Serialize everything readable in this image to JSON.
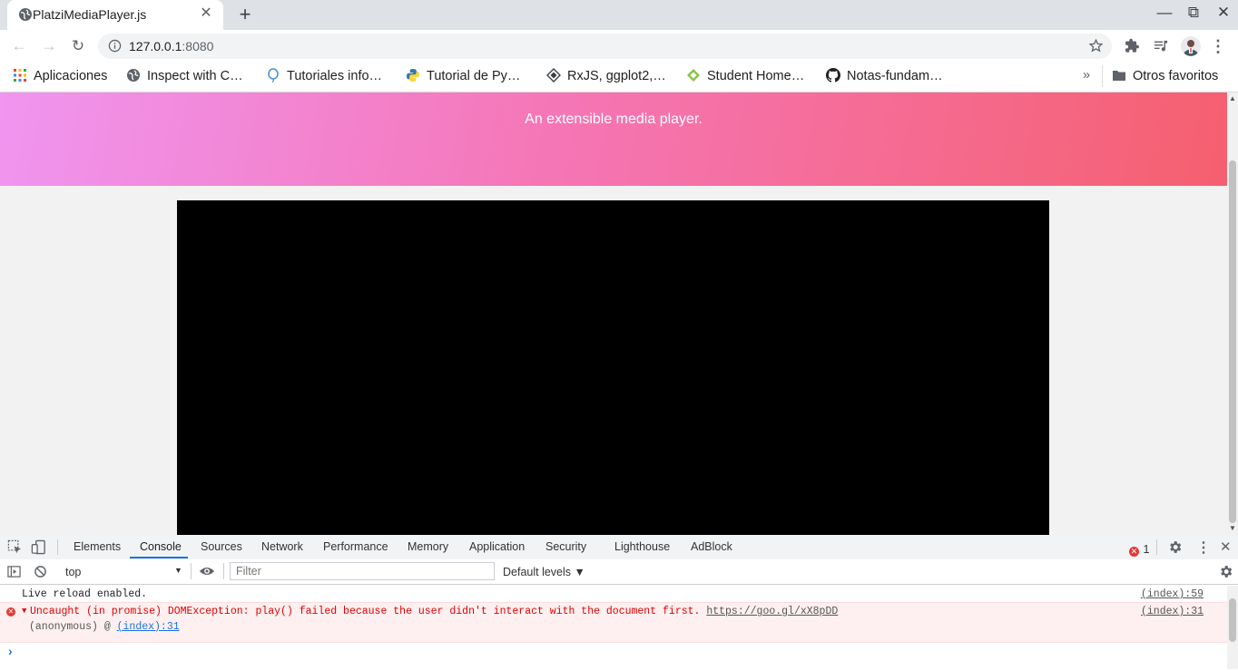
{
  "browser": {
    "tab_title": "PlatziMediaPlayer.js",
    "tab_close_glyph": "✕",
    "new_tab_glyph": "+",
    "window_controls": {
      "minimize": "—",
      "maximize": "⧉",
      "close": "✕"
    },
    "nav": {
      "back": "←",
      "forward": "→",
      "reload": "↻"
    },
    "url_host": "127.0.0.1",
    "url_port": ":8080",
    "bookmarks": [
      {
        "label": "Aplicaciones",
        "icon": "apps-grid-icon"
      },
      {
        "label": "Inspect with C…",
        "icon": "globe-icon"
      },
      {
        "label": "Tutoriales info…",
        "icon": "balloon-icon"
      },
      {
        "label": "Tutorial de Py…",
        "icon": "python-icon"
      },
      {
        "label": "RxJS, ggplot2,…",
        "icon": "diamond-icon"
      },
      {
        "label": "Student Home…",
        "icon": "leaf-icon"
      },
      {
        "label": "Notas-fundam…",
        "icon": "github-icon"
      }
    ],
    "bookmarks_overflow": "»",
    "other_bookmarks": "Otros favoritos"
  },
  "page": {
    "tagline": "An extensible media player."
  },
  "devtools": {
    "tabs": [
      "Elements",
      "Console",
      "Sources",
      "Network",
      "Performance",
      "Memory",
      "Application",
      "Security",
      "Lighthouse",
      "AdBlock"
    ],
    "active_tab": "Console",
    "error_count": "1",
    "context": "top",
    "filter_placeholder": "Filter",
    "levels": "Default levels ▼",
    "messages": [
      {
        "text": "Live reload enabled.",
        "source": "(index):59"
      },
      {
        "text": "Uncaught (in promise) DOMException: play() failed because the user didn't interact with the document first.",
        "link": "https://goo.gl/xX8pDD",
        "stack_prefix": "(anonymous) @",
        "stack_link": "(index):31",
        "source": "(index):31"
      }
    ],
    "prompt": "›"
  },
  "colors": {
    "hero_start": "#f095f0",
    "hero_end": "#f5606f",
    "error_text": "#e00000",
    "accent": "#1a73e8"
  }
}
